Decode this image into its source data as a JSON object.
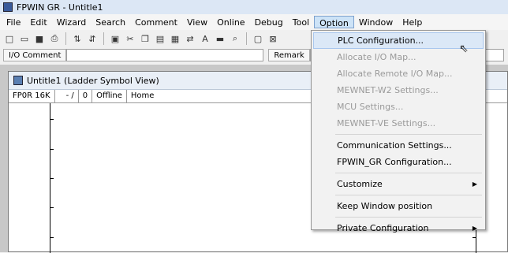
{
  "window": {
    "title": "FPWIN GR - Untitle1"
  },
  "menubar": {
    "items": [
      "File",
      "Edit",
      "Wizard",
      "Search",
      "Comment",
      "View",
      "Online",
      "Debug",
      "Tool",
      "Option",
      "Window",
      "Help"
    ],
    "active": "Option"
  },
  "toolbar": {
    "icons": [
      "new-icon",
      "open-icon",
      "save-icon",
      "print-icon",
      "monitor-icon",
      "monitor2-icon",
      "select-icon",
      "cut-icon",
      "copy-icon",
      "paste-icon",
      "grid-icon",
      "convert-icon",
      "text-icon",
      "fill-icon",
      "binoculars-icon",
      "window-icon",
      "stop-icon"
    ]
  },
  "commentbar": {
    "io_comment_label": "I/O Comment",
    "remark_label": "Remark"
  },
  "child_window": {
    "title": "Untitle1 (Ladder Symbol View)"
  },
  "statusline": {
    "model": "FP0R 16K",
    "mode": "- /",
    "count": "0",
    "online": "Offline",
    "pos": "Home"
  },
  "dropdown": {
    "items": [
      {
        "label": "PLC Configuration...",
        "enabled": true,
        "highlight": true
      },
      {
        "label": "Allocate I/O Map...",
        "enabled": false
      },
      {
        "label": "Allocate Remote I/O Map...",
        "enabled": false
      },
      {
        "label": "MEWNET-W2 Settings...",
        "enabled": false
      },
      {
        "label": "MCU Settings...",
        "enabled": false
      },
      {
        "label": "MEWNET-VE Settings...",
        "enabled": false
      },
      {
        "label": "Communication Settings...",
        "enabled": true
      },
      {
        "label": "FPWIN_GR Configuration...",
        "enabled": true
      },
      {
        "label": "Customize",
        "enabled": true,
        "submenu": true
      },
      {
        "label": "Keep Window position",
        "enabled": true
      },
      {
        "label": "Private Configuration",
        "enabled": true,
        "submenu": true
      }
    ]
  }
}
